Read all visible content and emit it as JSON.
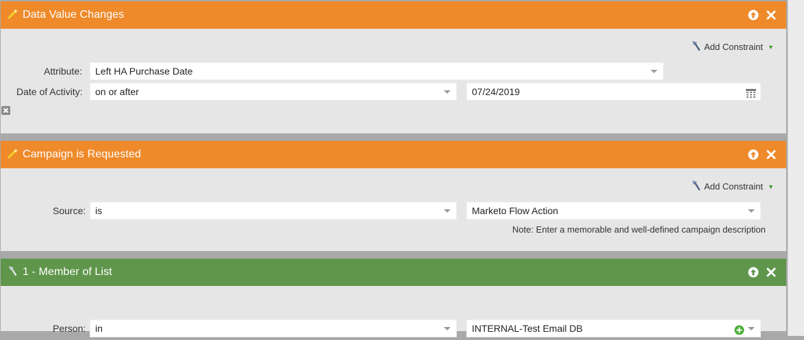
{
  "panels": [
    {
      "title": "Data Value Changes",
      "add_constraint": "Add Constraint",
      "attribute_label": "Attribute:",
      "attribute_value": "Left HA Purchase Date",
      "date_label": "Date of Activity:",
      "date_operator": "on or after",
      "date_value": "07/24/2019"
    },
    {
      "title": "Campaign is Requested",
      "add_constraint": "Add Constraint",
      "source_label": "Source:",
      "source_operator": "is",
      "source_value": "Marketo Flow Action",
      "note": "Note: Enter a memorable and well-defined campaign description"
    },
    {
      "title": "1 - Member of List",
      "person_label": "Person:",
      "person_operator": "in",
      "person_value": "INTERNAL-Test Email DB"
    }
  ],
  "colors": {
    "trigger_header": "#ef8a2b",
    "filter_header": "#5f964b",
    "panel_bg": "#e6e6e6",
    "divider": "#a9a9a9"
  }
}
